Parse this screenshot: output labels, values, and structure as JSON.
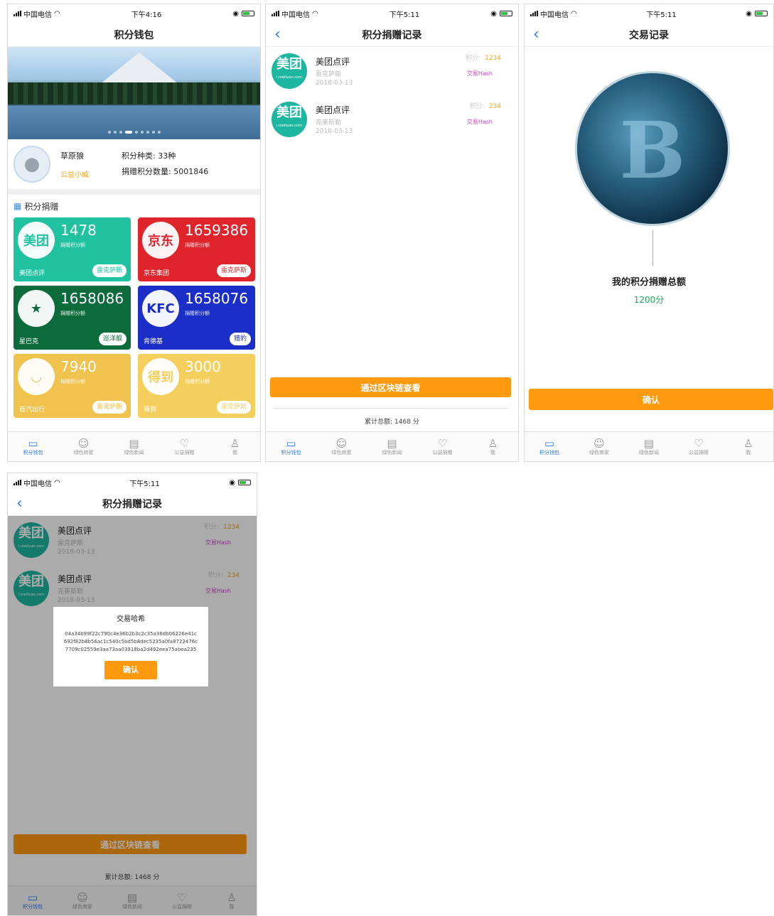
{
  "status": {
    "carrier": "中国电信",
    "time1": "下午4:16",
    "time2": "下午5:11"
  },
  "wallet": {
    "title": "积分钱包",
    "user_name": "草原狼",
    "user_tag": "公益小威",
    "kinds": "积分种类: 33种",
    "donated": "捐赠积分数量: 5001846",
    "section": "积分捐赠",
    "cards": [
      {
        "logo": "美团",
        "logo_sub": "i.meituan.com",
        "num": "1478",
        "sub": "捐赠积分额",
        "name": "美团点评",
        "pill": "雷克萨斯",
        "color": "#20c2a0",
        "pill_color": "#20c2a0"
      },
      {
        "logo": "京东",
        "logo_sub": "",
        "num": "1659386",
        "sub": "捐赠积分额",
        "name": "京东集团",
        "pill": "雷克萨斯",
        "color": "#e0242b",
        "pill_color": "#e0242b"
      },
      {
        "logo": "★",
        "logo_sub": "",
        "num": "1658086",
        "sub": "捐赠积分额",
        "name": "星巴克",
        "pill": "巡洋舰",
        "color": "#0b6b3a",
        "pill_color": "#0b6b3a"
      },
      {
        "logo": "KFC",
        "logo_sub": "",
        "num": "1658076",
        "sub": "捐赠积分额",
        "name": "肯德基",
        "pill": "猎豹",
        "color": "#1b2fc8",
        "pill_color": "#1b2fc8"
      },
      {
        "logo": "◡",
        "logo_sub": "首汽出行",
        "num": "7940",
        "sub": "捐赠积分额",
        "name": "首汽出行",
        "pill": "雷克萨斯",
        "color": "#f0c24e",
        "pill_color": "#f0c24e"
      },
      {
        "logo": "得到",
        "logo_sub": "",
        "num": "3000",
        "sub": "捐赠积分额",
        "name": "得到",
        "pill": "雷克萨斯",
        "color": "#f5cf5e",
        "pill_color": "#f5cf5e"
      }
    ]
  },
  "tabs": [
    "积分钱包",
    "绿色商家",
    "绿色新闻",
    "公益捐赠",
    "我"
  ],
  "records": {
    "title": "积分捐赠记录",
    "items": [
      {
        "brand": "美团点评",
        "car": "雷克萨斯",
        "date": "2018-03-13",
        "pts_label": "积分:",
        "pts": "1234",
        "hash": "交易Hash"
      },
      {
        "brand": "美团点评",
        "car": "克莱斯勒",
        "date": "2018-03-13",
        "pts_label": "积分:",
        "pts": "234",
        "hash": "交易Hash"
      }
    ],
    "chain_btn": "通过区块链查看",
    "total": "累计总额: 1468 分"
  },
  "trade": {
    "title": "交易记录",
    "total_label": "我的积分捐赠总额",
    "total_value": "1200分",
    "confirm": "确认"
  },
  "modal": {
    "title": "交易哈希",
    "hash": "04a34b99f22c790c4e36b2b3c2c35a36db06226e41c692f82b8b56ac1c540c5bd5b8dec5235a0fa8722476c7709c02559e3aa73aa03918ba2d492eea75abea235",
    "confirm": "确认"
  }
}
